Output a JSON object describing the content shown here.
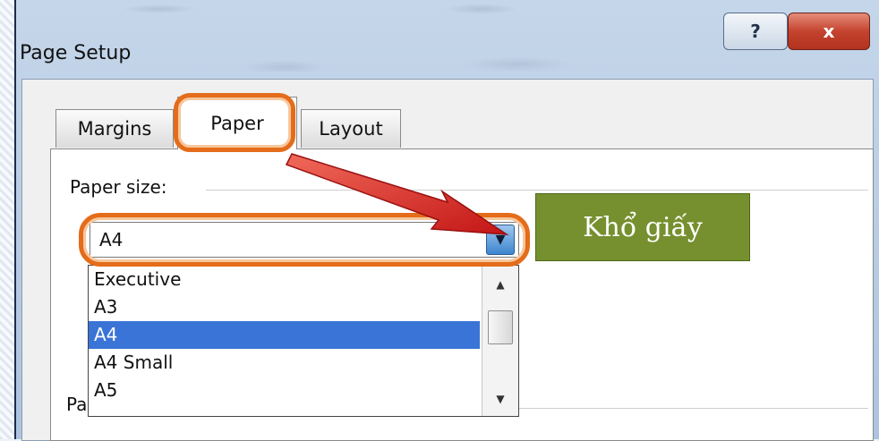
{
  "dialog": {
    "title": "Page Setup",
    "help_label": "?",
    "close_label": "x"
  },
  "tabs": [
    {
      "label": "Margins"
    },
    {
      "label": "Paper"
    },
    {
      "label": "Layout"
    }
  ],
  "paper_size": {
    "label": "Paper size:",
    "selected": "A4",
    "options": [
      "Executive",
      "A3",
      "A4",
      "A4 Small",
      "A5"
    ]
  },
  "partial_section_label": "Pa",
  "annotation": {
    "text": "Khổ giấy",
    "color": "#76902f"
  },
  "highlight_color": "#e46c1a",
  "arrow_color": "#d42020"
}
